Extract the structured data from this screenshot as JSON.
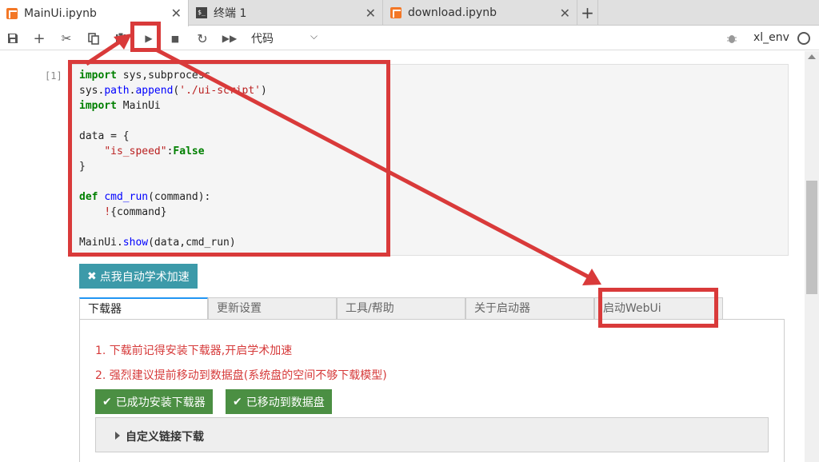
{
  "tabs": [
    {
      "label": "MainUi.ipynb",
      "icon": "notebook-icon"
    },
    {
      "label": "终端 1",
      "icon": "terminal-icon"
    },
    {
      "label": "download.ipynb",
      "icon": "notebook-icon"
    }
  ],
  "toolbar": {
    "cell_type": "代码",
    "kernel_name": "xl_env"
  },
  "cell": {
    "prompt": "[1]",
    "code": {
      "l1_kw": "import",
      "l1_rest": " sys,subprocess",
      "l2_a": "sys.",
      "l2_b": "path",
      "l2_c": ".",
      "l2_d": "append",
      "l2_e": "(",
      "l2_f": "'./ui-script'",
      "l2_g": ")",
      "l3_kw": "import",
      "l3_rest": " MainUi",
      "l5": "data = {",
      "l6_indent": "    ",
      "l6_key": "\"is_speed\"",
      "l6_colon": ":",
      "l6_val": "False",
      "l7": "}",
      "l9_kw": "def",
      "l9_sp": " ",
      "l9_fn": "cmd_run",
      "l9_rest": "(command):",
      "l10_indent": "    ",
      "l10_bang": "!",
      "l10_rest": "{command}",
      "l12_a": "MainUi.",
      "l12_b": "show",
      "l12_c": "(data,cmd_run)"
    }
  },
  "widget": {
    "accel_button": "点我自动学术加速",
    "tabs": [
      "下载器",
      "更新设置",
      "工具/帮助",
      "关于启动器",
      "启动WebUi"
    ],
    "notes": [
      "1. 下载前记得安装下载器,开启学术加速",
      "2. 强烈建议提前移动到数据盘(系统盘的空间不够下载模型)"
    ],
    "buttons": [
      "已成功安装下载器",
      "已移动到数据盘"
    ],
    "accordion": "自定义链接下载"
  },
  "colors": {
    "annotation": "#d93a3a",
    "accel_button": "#3c9aa9",
    "success_button": "#4b8f43",
    "note_text": "#d63a3a"
  }
}
